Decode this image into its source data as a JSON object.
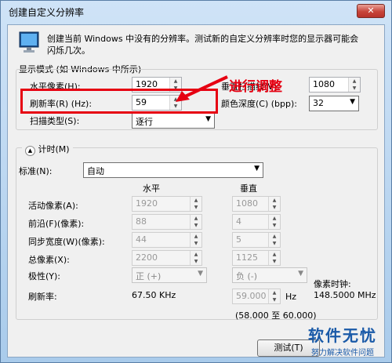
{
  "window": {
    "title": "创建自定义分辨率",
    "close_glyph": "✕"
  },
  "description": "创建当前 Windows 中没有的分辨率。测试新的自定义分辨率时您的显示器可能会闪烁几次。",
  "annotation": "进行调整",
  "display_mode": {
    "group_label": "显示模式 (如 Windows 中所示)",
    "h_pixels_label": "水平像素(H):",
    "h_pixels_value": "1920",
    "refresh_label": "刷新率(R) (Hz):",
    "refresh_value": "59",
    "scan_label": "扫描类型(S):",
    "scan_value": "逐行",
    "v_lines_label": "垂直扫描线(V):",
    "v_lines_value": "1080",
    "color_depth_label": "颜色深度(C) (bpp):",
    "color_depth_value": "32"
  },
  "timing": {
    "toggle_label": "计时(M)",
    "standard_label": "标准(N):",
    "standard_value": "自动",
    "col_horizontal": "水平",
    "col_vertical": "垂直",
    "active_label": "活动像素(A):",
    "active_h": "1920",
    "active_v": "1080",
    "front_label": "前沿(F)(像素):",
    "front_h": "88",
    "front_v": "4",
    "sync_label": "同步宽度(W)(像素):",
    "sync_h": "44",
    "sync_v": "5",
    "total_label": "总像素(X):",
    "total_h": "2200",
    "total_v": "1125",
    "polarity_label": "极性(Y):",
    "polarity_h": "正 (+)",
    "polarity_v": "负 (-)",
    "refresh_label": "刷新率:",
    "refresh_h_value": "67.50 KHz",
    "refresh_v_value": "59.000",
    "refresh_v_unit": "Hz",
    "range": "(58.000 至 60.000)",
    "pixel_clock_label": "像素时钟:",
    "pixel_clock_value": "148.5000 MHz"
  },
  "buttons": {
    "test": "测试(T)"
  },
  "watermark": {
    "big": "软件无忧",
    "small": "努力解决软件问题"
  }
}
